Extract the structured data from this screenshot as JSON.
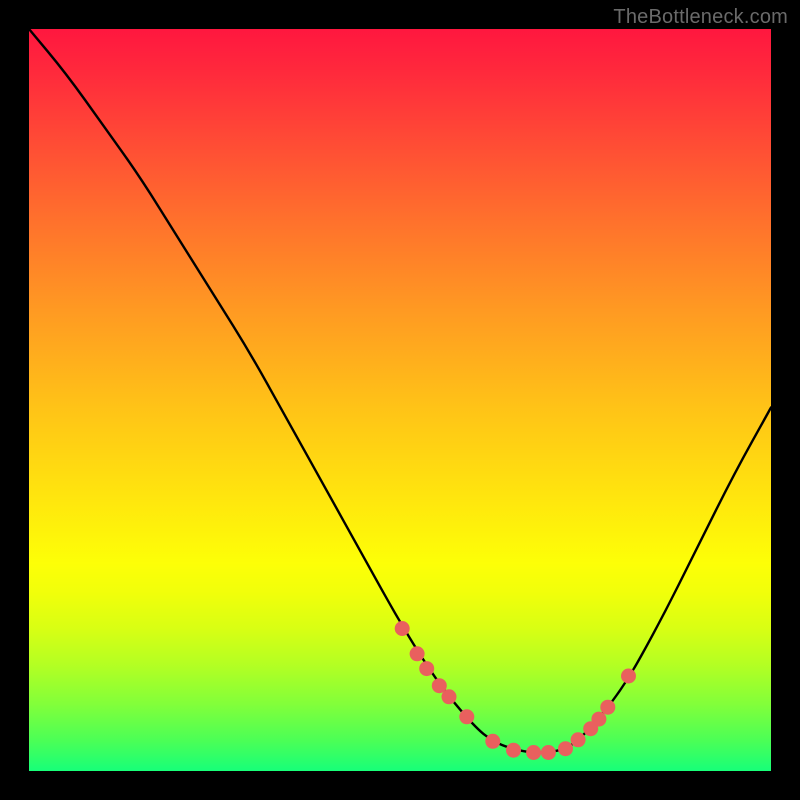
{
  "watermark": "TheBottleneck.com",
  "chart_data": {
    "type": "line",
    "title": "",
    "xlabel": "",
    "ylabel": "",
    "xlim": [
      0,
      100
    ],
    "ylim": [
      0,
      100
    ],
    "grid": false,
    "legend": false,
    "series": [
      {
        "name": "bottleneck-curve",
        "x": [
          0,
          5,
          10,
          15,
          20,
          25,
          30,
          35,
          40,
          45,
          50,
          55,
          60,
          62.5,
          65,
          67.5,
          70,
          72.5,
          75,
          80,
          85,
          90,
          95,
          100
        ],
        "y": [
          100,
          94,
          87,
          80,
          72,
          64,
          56,
          47,
          38,
          29,
          20,
          12,
          6,
          4,
          3,
          2.5,
          2.5,
          3,
          5,
          11,
          20,
          30,
          40,
          49
        ]
      }
    ],
    "markers": {
      "name": "highlight-points",
      "color": "#e9605e",
      "x": [
        50.3,
        52.3,
        53.6,
        55.3,
        56.6,
        59.0,
        62.5,
        65.3,
        68.0,
        70.0,
        72.3,
        74.0,
        75.7,
        76.8,
        78.0,
        80.8
      ],
      "y": [
        19.2,
        15.8,
        13.8,
        11.5,
        10.0,
        7.3,
        4.0,
        2.8,
        2.5,
        2.5,
        3.0,
        4.2,
        5.7,
        7.0,
        8.6,
        12.8
      ]
    },
    "gradient_stops": [
      {
        "pos": 0.0,
        "color": "#ff173f"
      },
      {
        "pos": 0.25,
        "color": "#ff6e2d"
      },
      {
        "pos": 0.5,
        "color": "#ffc317"
      },
      {
        "pos": 0.72,
        "color": "#fdff07"
      },
      {
        "pos": 1.0,
        "color": "#17ff79"
      }
    ]
  }
}
